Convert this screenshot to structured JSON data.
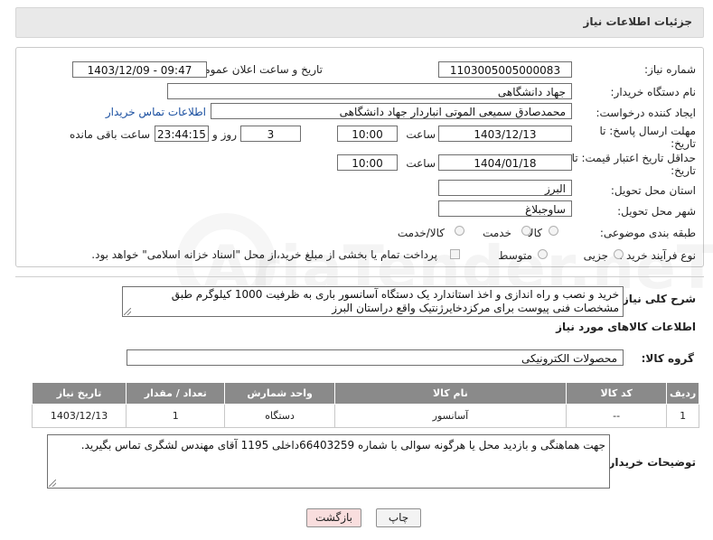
{
  "header": {
    "title": "جزئیات اطلاعات نیاز"
  },
  "form": {
    "need_number_label": "شماره نیاز:",
    "need_number": "1103005005000083",
    "announce_label": "تاریخ و ساعت اعلان عمومی:",
    "announce_value": "1403/12/09 - 09:47",
    "buyer_org_label": "نام دستگاه خریدار:",
    "buyer_org": "جهاد دانشگاهی",
    "creator_label": "ایجاد کننده درخواست:",
    "creator": "محمدصادق سمیعی الموتی انباردار جهاد دانشگاهی",
    "contact_link": "اطلاعات تماس خریدار",
    "deadline_label_1": "مهلت ارسال پاسخ: تا",
    "deadline_label_2": "تاریخ:",
    "deadline_date": "1403/12/13",
    "time_label": "ساعت",
    "deadline_time": "10:00",
    "days_value": "3",
    "days_label": "روز و",
    "remaining_time": "23:44:15",
    "remaining_label": "ساعت باقی مانده",
    "validity_label_1": "حداقل تاریخ اعتبار قیمت: تا",
    "validity_label_2": "تاریخ:",
    "validity_date": "1404/01/18",
    "validity_time": "10:00",
    "province_label": "استان محل تحویل:",
    "province": "البرز",
    "city_label": "شهر محل تحویل:",
    "city": "ساوجبلاغ",
    "category_label": "طبقه بندی موضوعی:",
    "category_options": [
      "کالا",
      "خدمت",
      "کالا/خدمت"
    ],
    "purchase_type_label": "نوع فرآیند خرید :",
    "purchase_options": [
      "جزیی",
      "متوسط"
    ],
    "treasury_note": "پرداخت تمام یا بخشی از مبلغ خرید،از محل \"اسناد خزانه اسلامی\" خواهد بود."
  },
  "description": {
    "label": "شرح کلی نیاز:",
    "text": "خرید  و نصب و راه اندازی و اخذ استاندارد یک دستگاه آسانسور باری به ظرفیت 1000 کیلوگرم طبق مشخصات فنی پیوست برای مرکزدخایرژنتیک واقع دراستان البرز"
  },
  "goods": {
    "section_title": "اطلاعات کالاهای مورد نیاز",
    "group_label": "گروه کالا:",
    "group_value": "محصولات الکترونیکی",
    "columns": [
      "ردیف",
      "کد کالا",
      "نام کالا",
      "واحد شمارش",
      "تعداد / مقدار",
      "تاریخ نیاز"
    ],
    "rows": [
      [
        "1",
        "--",
        "آسانسور",
        "دستگاه",
        "1",
        "1403/12/13"
      ]
    ]
  },
  "buyer_notes": {
    "label": "توضیحات خریدار:",
    "text": "جهت هماهنگی و بازدید محل یا هرگونه سوالی با شماره 66403259داخلی 1195 آقای مهندس لشگری تماس بگیرید."
  },
  "buttons": {
    "print": "چاپ",
    "back": "بازگشت"
  },
  "watermark": "AriaTender.neT",
  "colors": {
    "header_bg": "#e9e9e9",
    "table_header": "#8a8a8a",
    "link": "#1a4fa0",
    "back_btn": "#f9dede"
  }
}
